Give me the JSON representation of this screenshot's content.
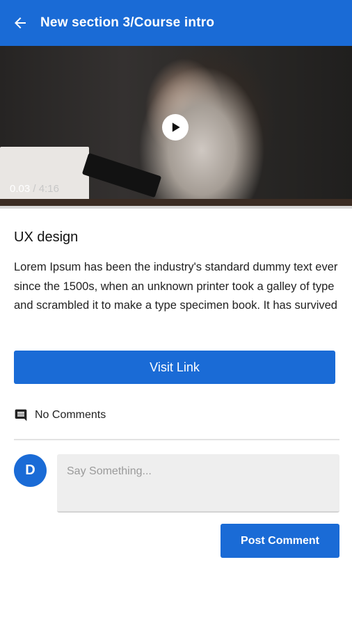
{
  "appbar": {
    "title": "New section 3/Course intro",
    "back_icon": "arrow-back-icon",
    "color": "#1a6bd6"
  },
  "video": {
    "current_time": "0.03",
    "separator": " / ",
    "duration": "4:16",
    "play_icon": "play-icon"
  },
  "course": {
    "title": "UX design",
    "description": "Lorem Ipsum has been the industry's standard dummy text ever since the 1500s, when an unknown printer took a galley of type and scrambled it to make a type specimen book. It has survived"
  },
  "actions": {
    "visit_link_label": "Visit Link"
  },
  "comments": {
    "icon": "comment-icon",
    "label": "No Comments",
    "avatar_letter": "D",
    "input_placeholder": "Say Something...",
    "input_value": "",
    "post_label": "Post Comment"
  }
}
